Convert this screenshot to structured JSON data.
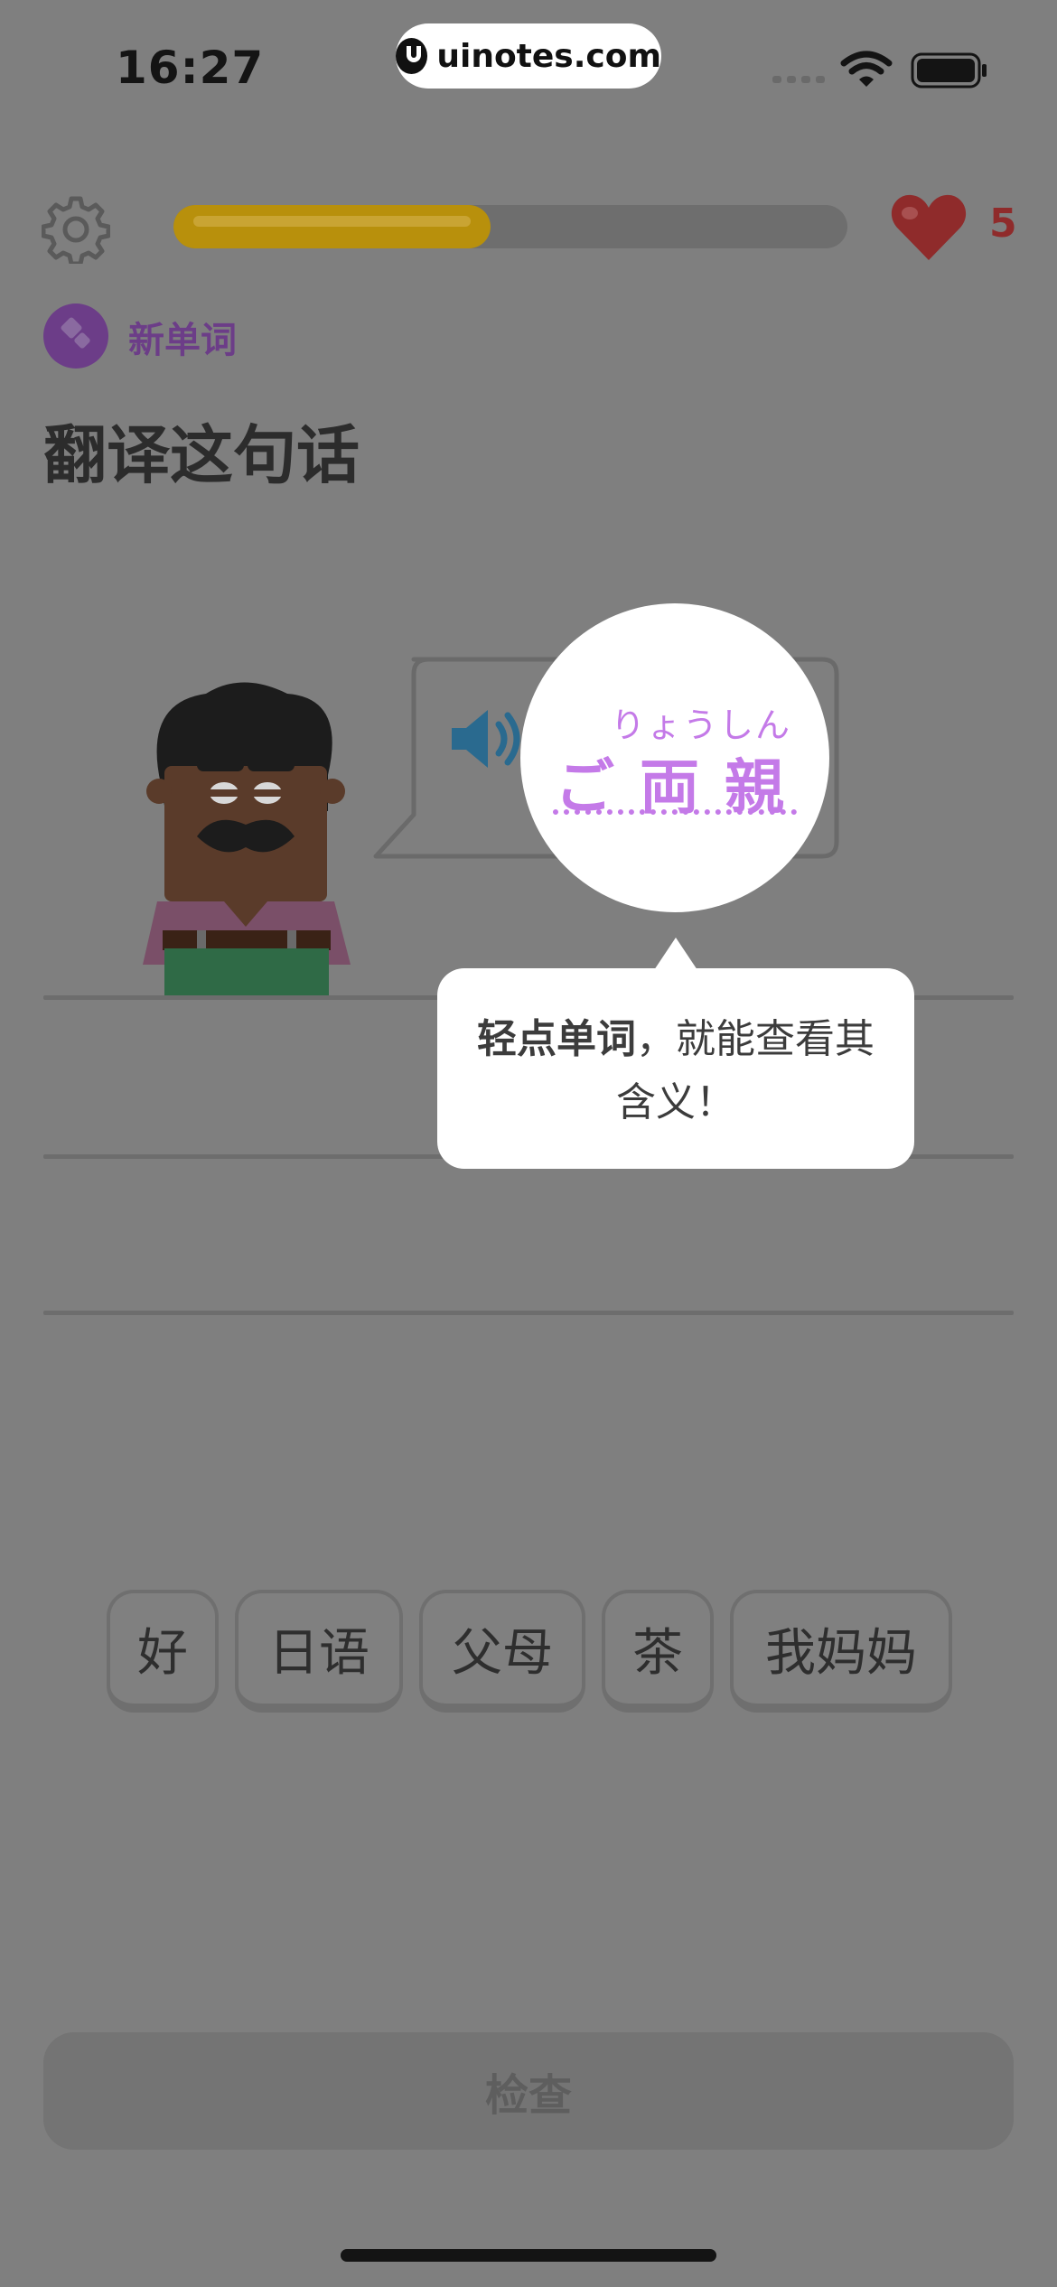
{
  "status_bar": {
    "time": "16:27",
    "watermark": "uinotes.com"
  },
  "top_bar": {
    "progress_percent": 47,
    "hearts_count": "5"
  },
  "header": {
    "badge_label": "新单词",
    "instruction": "翻译这句话"
  },
  "prompt": {
    "furigana": "りょうしん",
    "word": "ご両親"
  },
  "tooltip": {
    "bold_text": "轻点单词",
    "rest_text": "，就能查看其含义！"
  },
  "word_bank": [
    {
      "label": "好"
    },
    {
      "label": "日语"
    },
    {
      "label": "父母"
    },
    {
      "label": "茶"
    },
    {
      "label": "我妈妈"
    }
  ],
  "check_button": {
    "label": "检查"
  },
  "colors": {
    "overlay_gray": "#7f7f7f",
    "progress_gold": "#b8900c",
    "badge_purple": "#6c3d88",
    "hint_purple": "#c47ae8",
    "heart_red": "#8f2b2b"
  }
}
